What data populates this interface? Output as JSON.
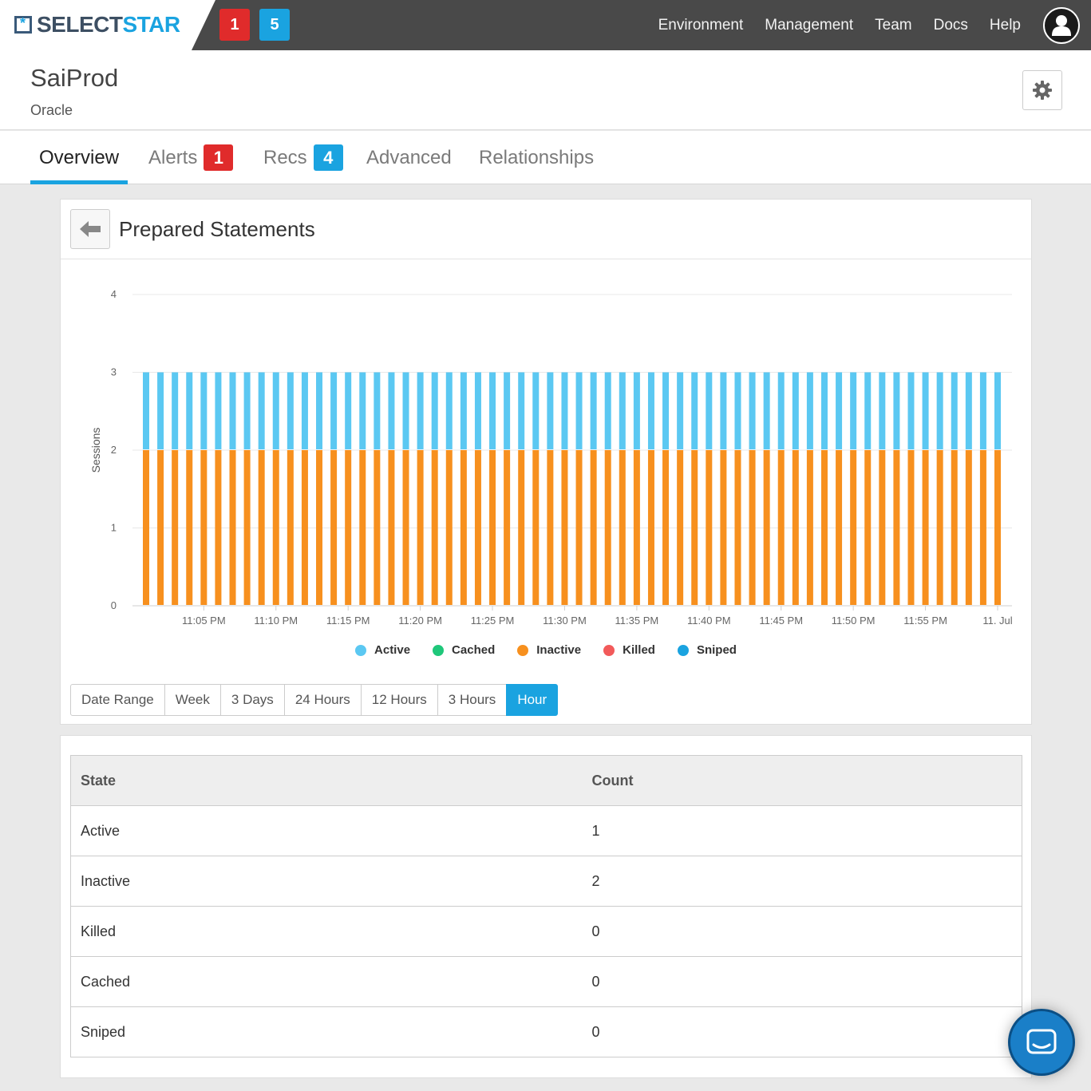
{
  "brand": {
    "name_part1": "SELECT",
    "name_part2": "STAR"
  },
  "topbar": {
    "alert_badge": "1",
    "rec_badge": "5",
    "nav": [
      "Environment",
      "Management",
      "Team",
      "Docs",
      "Help"
    ]
  },
  "header": {
    "title": "SaiProd",
    "subtitle": "Oracle"
  },
  "tabs": [
    {
      "label": "Overview",
      "active": true
    },
    {
      "label": "Alerts",
      "badge": "1",
      "badge_color": "#e02b2b"
    },
    {
      "label": "Recs",
      "badge": "4",
      "badge_color": "#1aa3e0"
    },
    {
      "label": "Advanced"
    },
    {
      "label": "Relationships"
    }
  ],
  "chart_card": {
    "title": "Prepared Statements"
  },
  "chart_data": {
    "type": "bar",
    "stacked": true,
    "ylabel": "Sessions",
    "ylim": [
      0,
      4
    ],
    "yticks": [
      0,
      1,
      2,
      3,
      4
    ],
    "xtick_labels": [
      "11:05 PM",
      "11:10 PM",
      "11:15 PM",
      "11:20 PM",
      "11:25 PM",
      "11:30 PM",
      "11:35 PM",
      "11:40 PM",
      "11:45 PM",
      "11:50 PM",
      "11:55 PM",
      "11. Jul"
    ],
    "bar_interval_minutes": 1,
    "bar_count": 60,
    "series": [
      {
        "name": "Active",
        "color": "#5bc8f2",
        "value_per_bar": 1
      },
      {
        "name": "Cached",
        "color": "#1fc77a",
        "value_per_bar": 0
      },
      {
        "name": "Inactive",
        "color": "#f7901e",
        "value_per_bar": 2
      },
      {
        "name": "Killed",
        "color": "#f25a5a",
        "value_per_bar": 0
      },
      {
        "name": "Sniped",
        "color": "#1aa3e0",
        "value_per_bar": 0
      }
    ],
    "grid": true,
    "legend_position": "bottom-center"
  },
  "range_buttons": [
    {
      "label": "Date Range"
    },
    {
      "label": "Week"
    },
    {
      "label": "3 Days"
    },
    {
      "label": "24 Hours"
    },
    {
      "label": "12 Hours"
    },
    {
      "label": "3 Hours"
    },
    {
      "label": "Hour",
      "active": true
    }
  ],
  "table": {
    "headers": [
      "State",
      "Count"
    ],
    "rows": [
      [
        "Active",
        "1"
      ],
      [
        "Inactive",
        "2"
      ],
      [
        "Killed",
        "0"
      ],
      [
        "Cached",
        "0"
      ],
      [
        "Sniped",
        "0"
      ]
    ]
  },
  "icons": {
    "user": "user-icon",
    "settings": "gear-icon",
    "back": "arrow-left-icon",
    "chat": "chat-icon"
  },
  "colors": {
    "accent": "#1aa3e0",
    "alert": "#e02b2b",
    "topbar": "#494949"
  }
}
